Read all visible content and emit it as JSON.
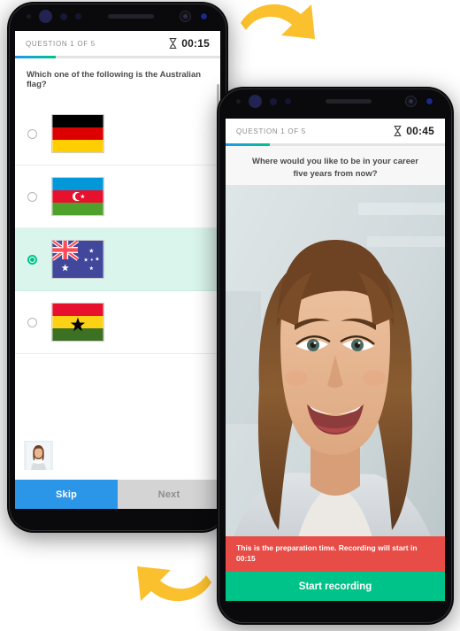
{
  "phone_quiz": {
    "header": {
      "question_counter": "QUESTION 1 OF 5",
      "timer": "00:15",
      "timer_icon": "hourglass-icon",
      "progress_percent": 20
    },
    "question_title": "Which one of the following is the Australian flag?",
    "options": [
      {
        "id": "germany",
        "flag_name": "germany-flag",
        "selected": false
      },
      {
        "id": "azerbaijan",
        "flag_name": "azerbaijan-flag",
        "selected": false
      },
      {
        "id": "australia",
        "flag_name": "australia-flag",
        "selected": true
      },
      {
        "id": "ghana",
        "flag_name": "ghana-flag",
        "selected": false
      }
    ],
    "pip_label": "self-view-thumbnail",
    "buttons": {
      "skip": "Skip",
      "next": "Next"
    }
  },
  "phone_video": {
    "header": {
      "question_counter": "QUESTION 1 OF 5",
      "timer": "00:45",
      "timer_icon": "hourglass-icon",
      "progress_percent": 20
    },
    "question_prompt": "Where would you like to be in your career five years from now?",
    "warning": "This is the preparation time. Recording will start in 00:15",
    "record_button": "Start recording"
  },
  "decoration": {
    "arrow_top": "curved-arrow-down-right",
    "arrow_bottom": "curved-arrow-left",
    "arrow_color": "#fbc02d"
  },
  "colors": {
    "accent_blue": "#2b96e8",
    "accent_green": "#00c389",
    "warning_red": "#e84c46",
    "selected_row": "#d9f5ec",
    "disabled_gray": "#d4d4d4"
  }
}
